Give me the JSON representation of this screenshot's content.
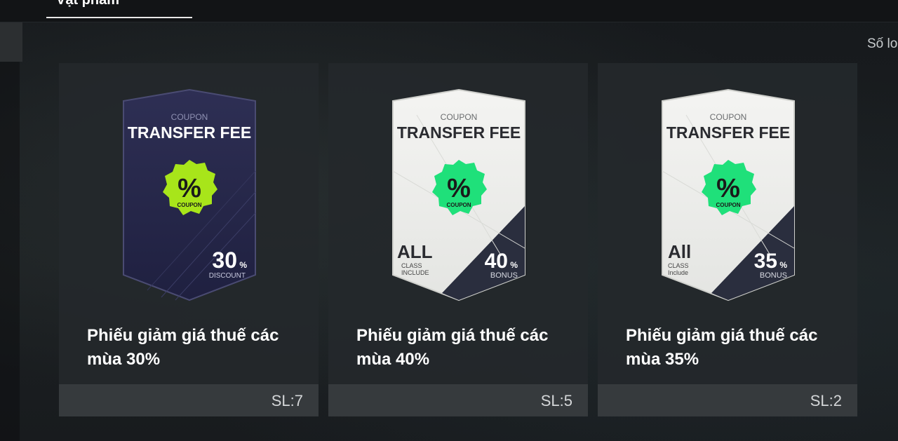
{
  "header": {
    "tab_label": "Vật phẩm"
  },
  "sort": {
    "label": "Số lo"
  },
  "cards": [
    {
      "name": "Phiếu giảm giá thuế các mùa 30%",
      "quantity": "SL:7",
      "coupon": {
        "top_label": "COUPON",
        "title": "TRANSFER FEE",
        "badge_symbol": "%",
        "badge_label": "COUPON",
        "value": "30",
        "value_unit": "%",
        "value_caption": "DISCOUNT",
        "style": "dark",
        "badge_color": "#a8e51a"
      }
    },
    {
      "name": "Phiếu giảm giá thuế các mùa 40%",
      "quantity": "SL:5",
      "coupon": {
        "top_label": "COUPON",
        "title": "TRANSFER FEE",
        "badge_symbol": "%",
        "badge_label": "COUPON",
        "class_big": "ALL",
        "class_small1": "CLASS",
        "class_small2": "INCLUDE",
        "value": "40",
        "value_unit": "%",
        "value_caption": "BONUS",
        "style": "light",
        "badge_color": "#1fe07a"
      }
    },
    {
      "name": "Phiếu giảm giá thuế các mùa 35%",
      "quantity": "SL:2",
      "coupon": {
        "top_label": "COUPON",
        "title": "TRANSFER FEE",
        "badge_symbol": "%",
        "badge_label": "COUPON",
        "class_big": "All",
        "class_small1": "CLASS",
        "class_small2": "Include",
        "value": "35",
        "value_unit": "%",
        "value_caption": "BONUS",
        "style": "light",
        "badge_color": "#1fe07a"
      }
    }
  ]
}
